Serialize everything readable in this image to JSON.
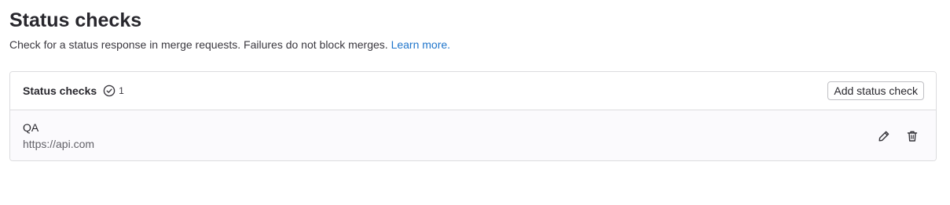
{
  "header": {
    "title": "Status checks",
    "description": "Check for a status response in merge requests. Failures do not block merges.",
    "learn_more": "Learn more."
  },
  "card": {
    "title": "Status checks",
    "count": "1",
    "count_icon": "check-circle-icon",
    "add_button_label": "Add status check"
  },
  "checks": [
    {
      "name": "QA",
      "url": "https://api.com",
      "edit_icon": "pencil-icon",
      "delete_icon": "trash-icon"
    }
  ],
  "colors": {
    "link": "#1f75cb",
    "border": "#dcdcde",
    "row_background": "#fbfafd"
  }
}
